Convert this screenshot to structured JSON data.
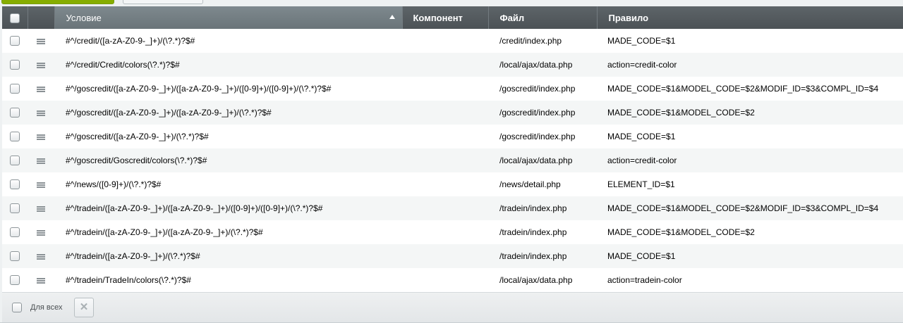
{
  "table": {
    "columns": {
      "condition": "Условие",
      "component": "Компонент",
      "file": "Файл",
      "rule": "Правило"
    },
    "rows": [
      {
        "condition": "#^/credit/([a-zA-Z0-9-_]+)/(\\?.*)?$#",
        "component": "",
        "file": "/credit/index.php",
        "rule": "MADE_CODE=$1"
      },
      {
        "condition": "#^/credit/Credit/colors(\\?.*)?$#",
        "component": "",
        "file": "/local/ajax/data.php",
        "rule": "action=credit-color"
      },
      {
        "condition": "#^/goscredit/([a-zA-Z0-9-_]+)/([a-zA-Z0-9-_]+)/([0-9]+)/([0-9]+)/(\\?.*)?$#",
        "component": "",
        "file": "/goscredit/index.php",
        "rule": "MADE_CODE=$1&MODEL_CODE=$2&MODIF_ID=$3&COMPL_ID=$4"
      },
      {
        "condition": "#^/goscredit/([a-zA-Z0-9-_]+)/([a-zA-Z0-9-_]+)/(\\?.*)?$#",
        "component": "",
        "file": "/goscredit/index.php",
        "rule": "MADE_CODE=$1&MODEL_CODE=$2"
      },
      {
        "condition": "#^/goscredit/([a-zA-Z0-9-_]+)/(\\?.*)?$#",
        "component": "",
        "file": "/goscredit/index.php",
        "rule": "MADE_CODE=$1"
      },
      {
        "condition": "#^/goscredit/Goscredit/colors(\\?.*)?$#",
        "component": "",
        "file": "/local/ajax/data.php",
        "rule": "action=credit-color"
      },
      {
        "condition": "#^/news/([0-9]+)/(\\?.*)?$#",
        "component": "",
        "file": "/news/detail.php",
        "rule": "ELEMENT_ID=$1"
      },
      {
        "condition": "#^/tradein/([a-zA-Z0-9-_]+)/([a-zA-Z0-9-_]+)/([0-9]+)/([0-9]+)/(\\?.*)?$#",
        "component": "",
        "file": "/tradein/index.php",
        "rule": "MADE_CODE=$1&MODEL_CODE=$2&MODIF_ID=$3&COMPL_ID=$4"
      },
      {
        "condition": "#^/tradein/([a-zA-Z0-9-_]+)/([a-zA-Z0-9-_]+)/(\\?.*)?$#",
        "component": "",
        "file": "/tradein/index.php",
        "rule": "MADE_CODE=$1&MODEL_CODE=$2"
      },
      {
        "condition": "#^/tradein/([a-zA-Z0-9-_]+)/(\\?.*)?$#",
        "component": "",
        "file": "/tradein/index.php",
        "rule": "MADE_CODE=$1"
      },
      {
        "condition": "#^/tradein/TradeIn/colors(\\?.*)?$#",
        "component": "",
        "file": "/local/ajax/data.php",
        "rule": "action=tradein-color"
      }
    ]
  },
  "footer": {
    "for_all_label": "Для всех",
    "delete_icon": "close-icon",
    "delete_glyph": "✕"
  },
  "colors": {
    "header_bg": "#4f5559",
    "sorted_header_bg": "#747e83",
    "row_alt_bg": "#f4f6f6"
  }
}
